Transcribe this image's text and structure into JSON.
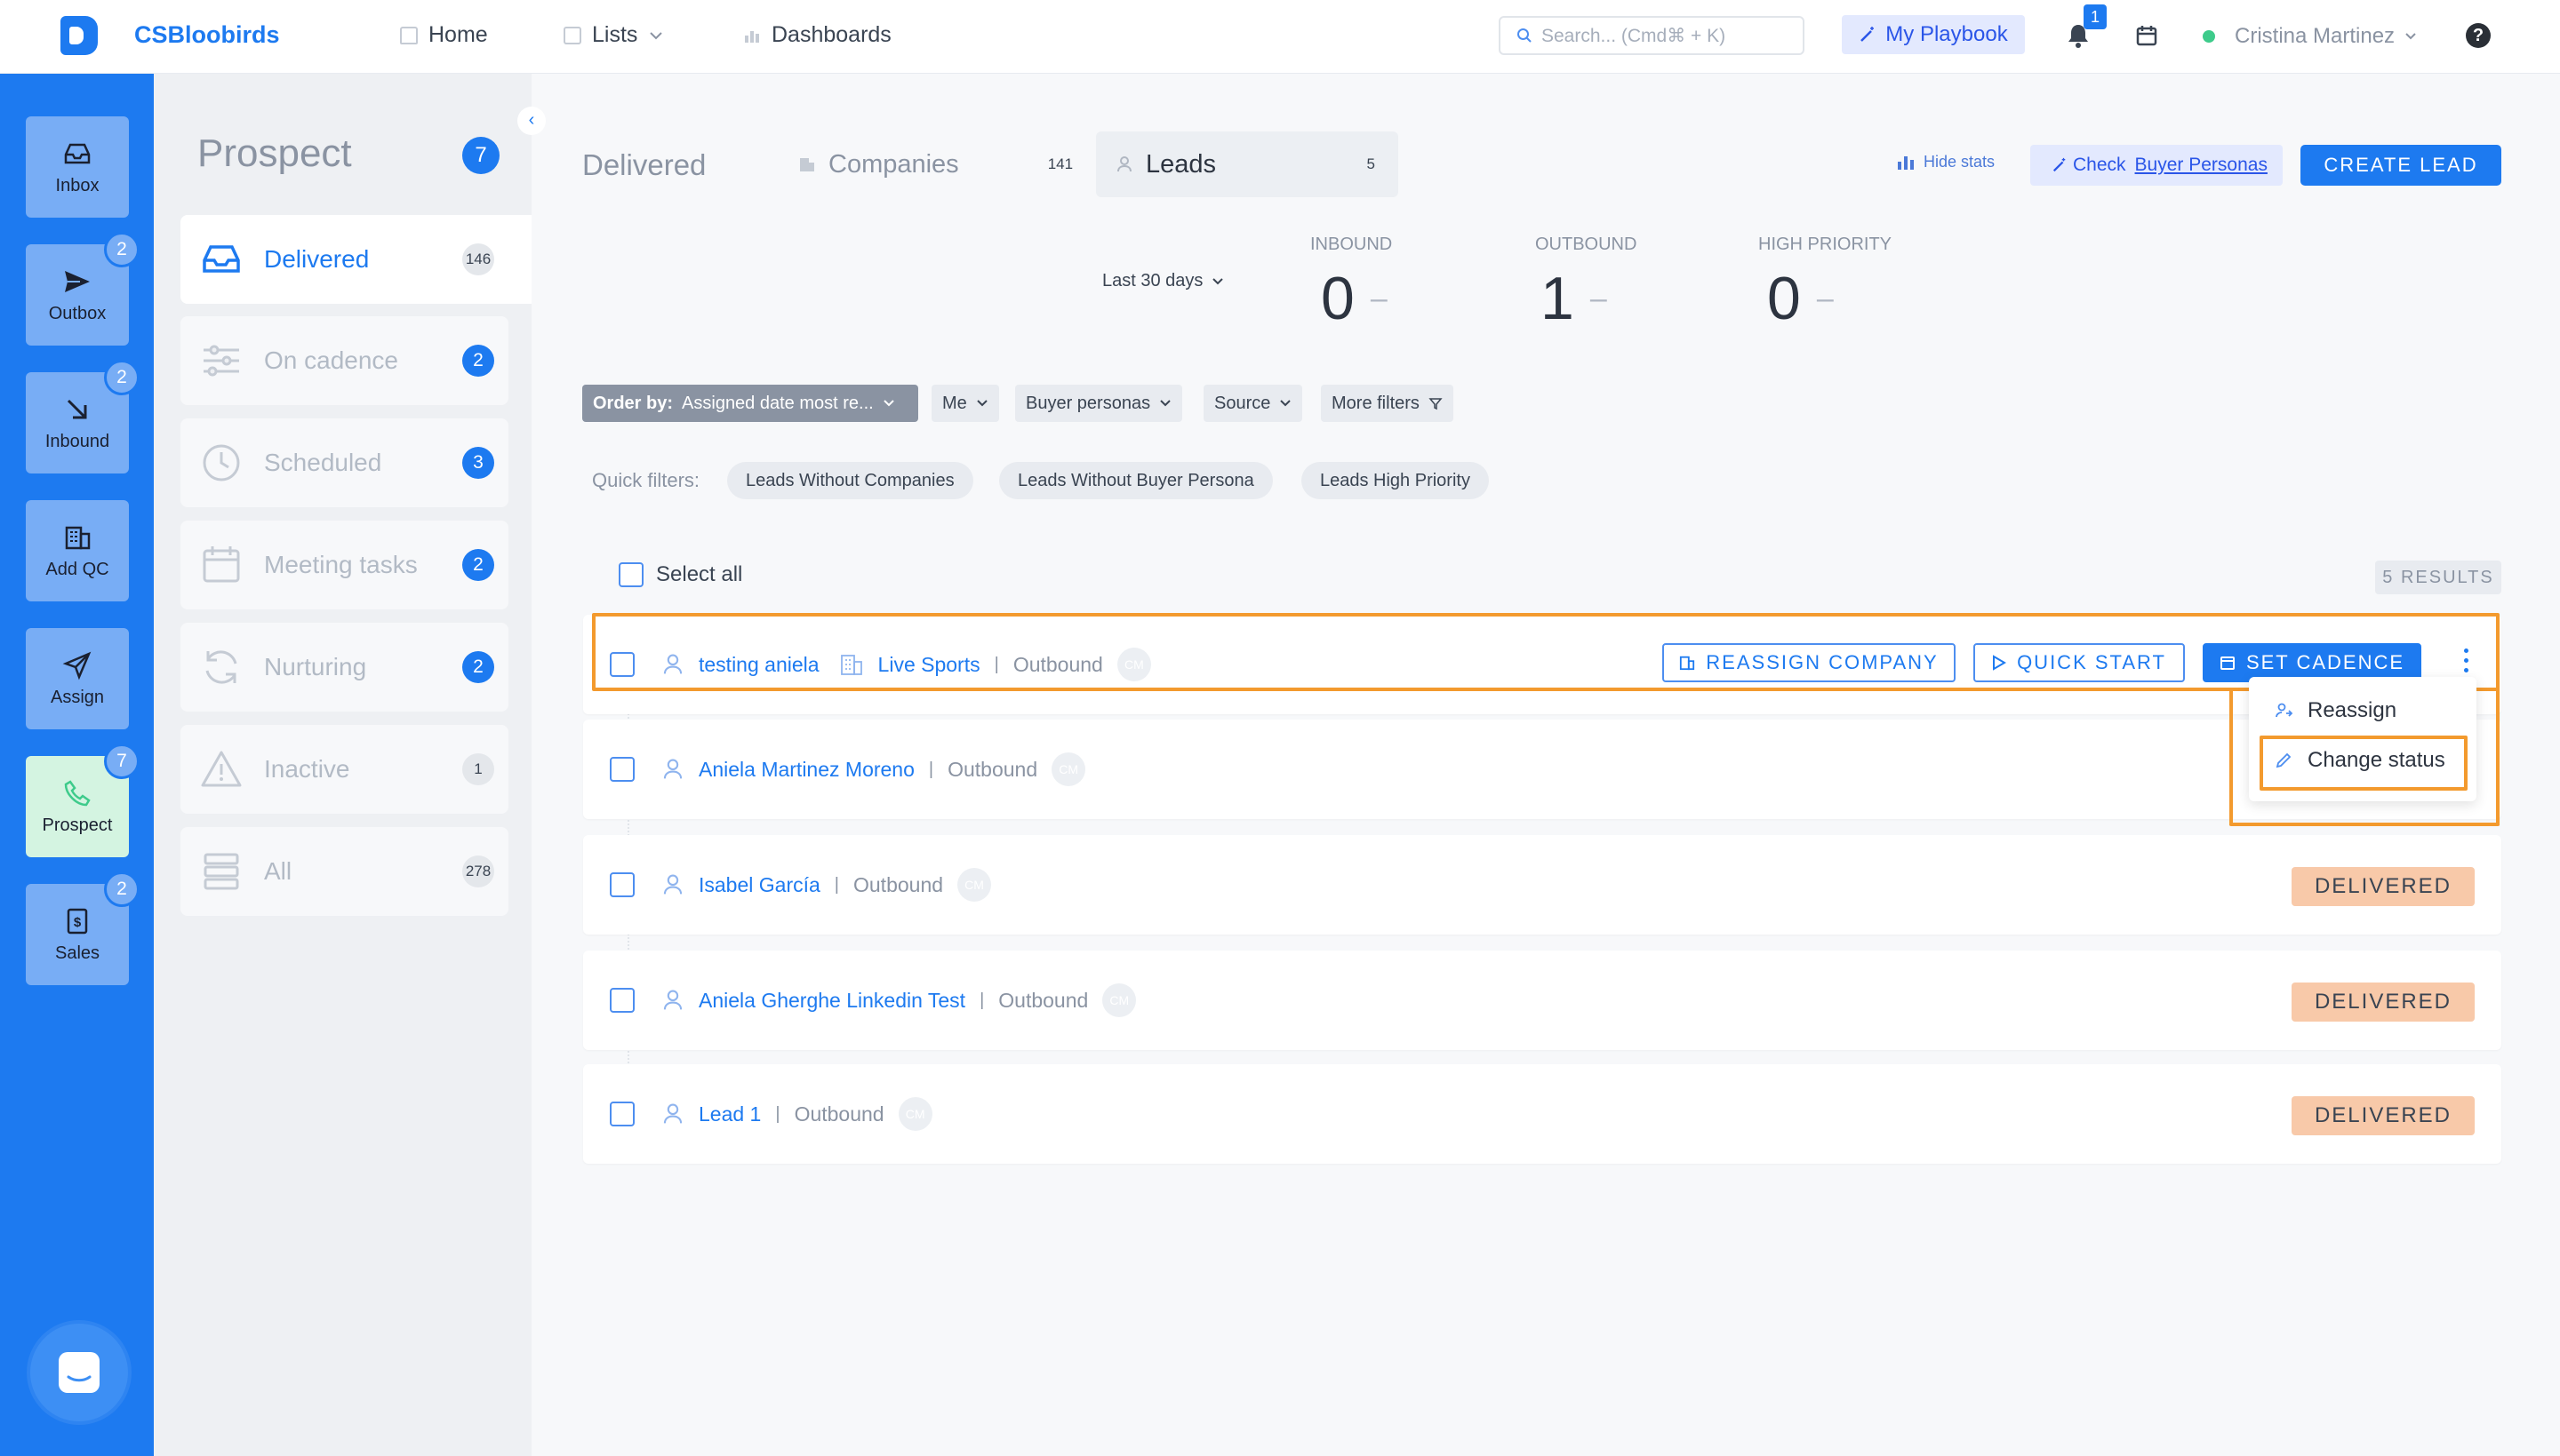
{
  "app": {
    "brand": "CSBloobirds"
  },
  "topnav": {
    "home": "Home",
    "lists": "Lists",
    "dashboards": "Dashboards",
    "search_placeholder": "Search... (Cmd⌘ + K)",
    "playbook": "My Playbook",
    "notifications": "1",
    "user": "Cristina Martinez",
    "help": "?"
  },
  "leftnav": {
    "items": [
      {
        "label": "Inbox",
        "icon": "inbox-icon",
        "badge": ""
      },
      {
        "label": "Outbox",
        "icon": "send-icon",
        "badge": "2"
      },
      {
        "label": "Inbound",
        "icon": "arrow-down-right-icon",
        "badge": "2"
      },
      {
        "label": "Add QC",
        "icon": "building-icon",
        "badge": ""
      },
      {
        "label": "Assign",
        "icon": "paper-plane-icon",
        "badge": ""
      },
      {
        "label": "Prospect",
        "icon": "phone-icon",
        "badge": "7"
      },
      {
        "label": "Sales",
        "icon": "dollar-icon",
        "badge": "2"
      }
    ]
  },
  "subnav": {
    "title": "Prospect",
    "count": "7",
    "items": [
      {
        "label": "Delivered",
        "count": "146"
      },
      {
        "label": "On cadence",
        "count": "2"
      },
      {
        "label": "Scheduled",
        "count": "3"
      },
      {
        "label": "Meeting tasks",
        "count": "2"
      },
      {
        "label": "Nurturing",
        "count": "2"
      },
      {
        "label": "Inactive",
        "count": "1"
      },
      {
        "label": "All",
        "count": "278"
      }
    ]
  },
  "header": {
    "title": "Delivered",
    "tabs": [
      {
        "label": "Companies",
        "count": "141"
      },
      {
        "label": "Leads",
        "count": "5"
      }
    ],
    "hide_stats": "Hide stats",
    "check_prefix": "Check",
    "check_link": "Buyer Personas",
    "create_lead": "CREATE LEAD"
  },
  "stats": {
    "period": "Last 30 days",
    "items": [
      {
        "label": "INBOUND",
        "value": "0",
        "trend": "–"
      },
      {
        "label": "OUTBOUND",
        "value": "1",
        "trend": "–"
      },
      {
        "label": "HIGH PRIORITY",
        "value": "0",
        "trend": "–"
      }
    ]
  },
  "filters": {
    "order_label": "Order by:",
    "order_value": "Assigned date most re...",
    "me": "Me",
    "buyer_personas": "Buyer personas",
    "source": "Source",
    "more": "More filters",
    "quick_label": "Quick filters:",
    "quick": [
      "Leads Without Companies",
      "Leads Without Buyer Persona",
      "Leads High Priority"
    ]
  },
  "list": {
    "select_all": "Select all",
    "results": "5 RESULTS",
    "rows": [
      {
        "name": "testing aniela",
        "company": "Live Sports",
        "source": "Outbound",
        "avatar": "CM",
        "status": ""
      },
      {
        "name": "Aniela Martinez Moreno",
        "company": "",
        "source": "Outbound",
        "avatar": "CM",
        "status": ""
      },
      {
        "name": "Isabel García",
        "company": "",
        "source": "Outbound",
        "avatar": "CM",
        "status": "DELIVERED"
      },
      {
        "name": "Aniela Gherghe Linkedin Test",
        "company": "",
        "source": "Outbound",
        "avatar": "CM",
        "status": "DELIVERED"
      },
      {
        "name": "Lead 1",
        "company": "",
        "source": "Outbound",
        "avatar": "CM",
        "status": "DELIVERED"
      }
    ],
    "actions": {
      "reassign_company": "REASSIGN COMPANY",
      "quick_start": "QUICK START",
      "set_cadence": "SET CADENCE"
    },
    "menu": {
      "reassign": "Reassign",
      "change_status": "Change status"
    }
  },
  "colors": {
    "primary": "#1d7af0",
    "highlight": "#f39a2e",
    "delivered": "#f8c9a9"
  }
}
